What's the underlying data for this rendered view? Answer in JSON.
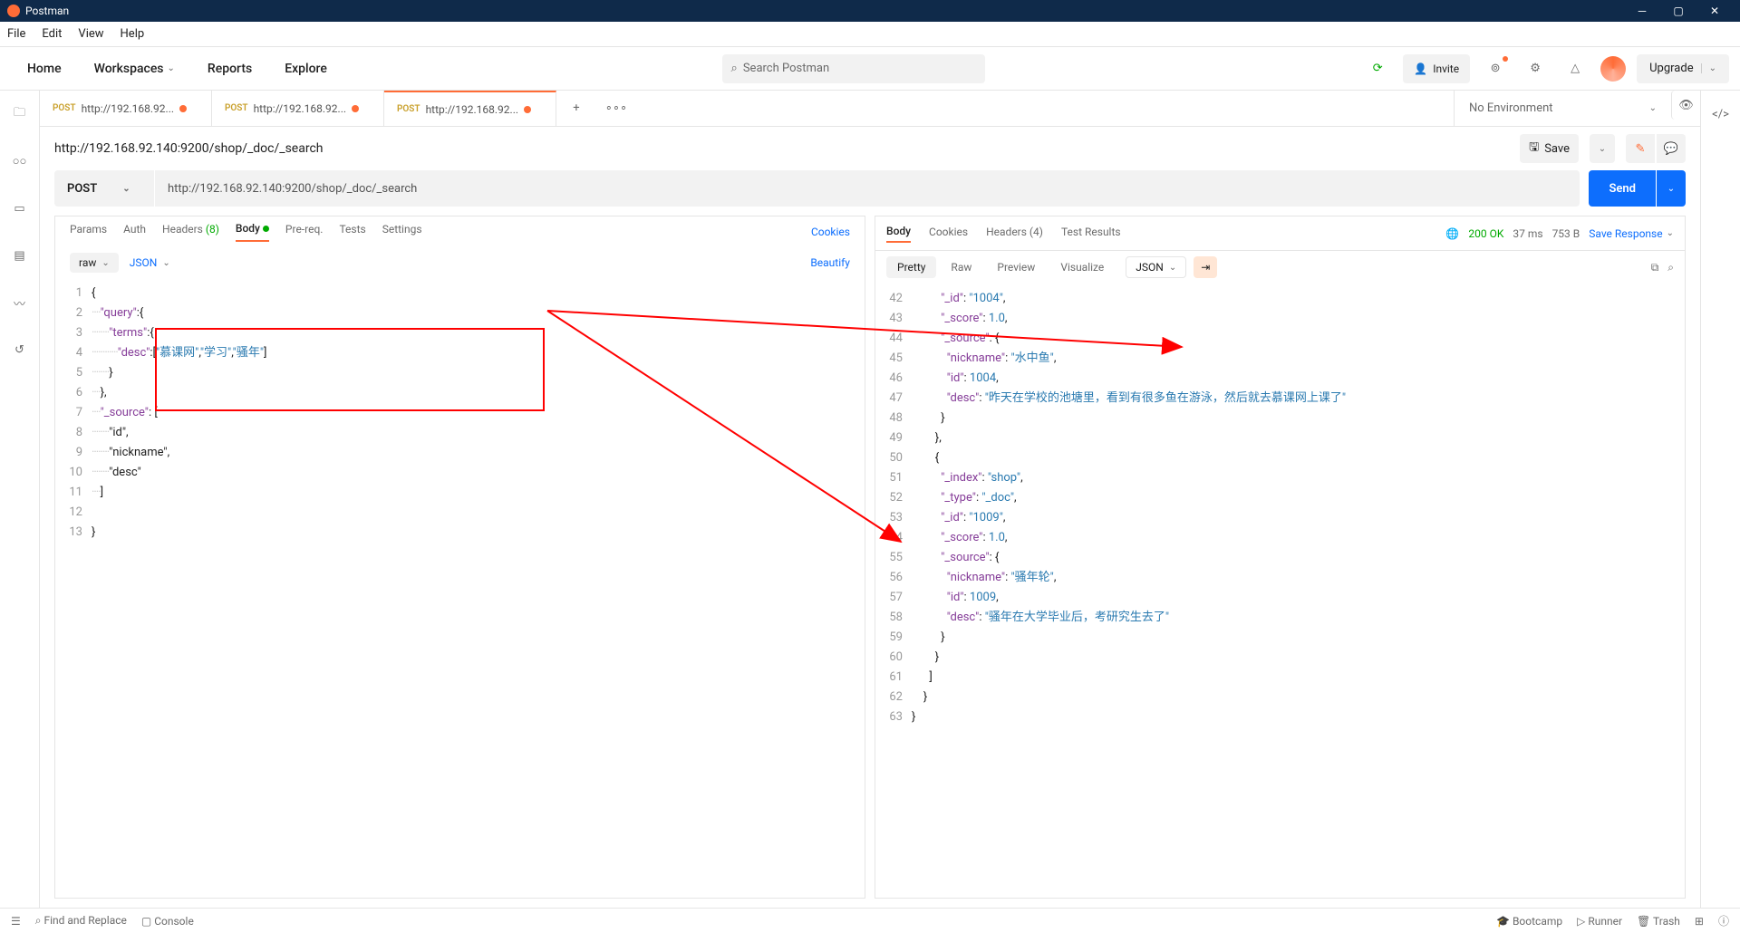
{
  "title_bar": {
    "app_name": "Postman"
  },
  "menu": {
    "file": "File",
    "edit": "Edit",
    "view": "View",
    "help": "Help"
  },
  "top_nav": {
    "home": "Home",
    "workspaces": "Workspaces",
    "reports": "Reports",
    "explore": "Explore",
    "search_placeholder": "Search Postman",
    "invite": "Invite",
    "upgrade": "Upgrade"
  },
  "tabs": [
    {
      "method": "POST",
      "url": "http://192.168.92...",
      "active": false
    },
    {
      "method": "POST",
      "url": "http://192.168.92...",
      "active": false
    },
    {
      "method": "POST",
      "url": "http://192.168.92...",
      "active": true
    }
  ],
  "env": "No Environment",
  "request": {
    "title": "http://192.168.92.140:9200/shop/_doc/_search",
    "save": "Save",
    "method": "POST",
    "url": "http://192.168.92.140:9200/shop/_doc/_search",
    "send": "Send"
  },
  "req_tabs": {
    "params": "Params",
    "auth": "Auth",
    "headers": "Headers",
    "headers_count": "(8)",
    "body": "Body",
    "prereq": "Pre-req.",
    "tests": "Tests",
    "settings": "Settings",
    "cookies": "Cookies"
  },
  "body_ctrl": {
    "raw": "raw",
    "json": "JSON",
    "beautify": "Beautify"
  },
  "request_body_lines": [
    "{",
    "····\"query\":{",
    "········\"terms\":{",
    "············\"desc\":[\"慕课网\",\"学习\",\"骚年\"]",
    "········}",
    "····},",
    "····\"_source\": [",
    "········\"id\",",
    "········\"nickname\",",
    "········\"desc\"",
    "····]",
    "",
    "}"
  ],
  "resp_tabs": {
    "body": "Body",
    "cookies": "Cookies",
    "headers": "Headers",
    "headers_count": "(4)",
    "results": "Test Results",
    "status": "200 OK",
    "time": "37 ms",
    "size": "753 B",
    "save_resp": "Save Response"
  },
  "resp_ctrl": {
    "pretty": "Pretty",
    "raw": "Raw",
    "preview": "Preview",
    "visualize": "Visualize",
    "json": "JSON"
  },
  "response_lines": [
    {
      "n": 42,
      "indent": 10,
      "txt": "\"_id\": \"1004\","
    },
    {
      "n": 43,
      "indent": 10,
      "txt": "\"_score\": 1.0,"
    },
    {
      "n": 44,
      "indent": 10,
      "txt": "\"_source\": {"
    },
    {
      "n": 45,
      "indent": 12,
      "txt": "\"nickname\": \"水中鱼\","
    },
    {
      "n": 46,
      "indent": 12,
      "txt": "\"id\": 1004,"
    },
    {
      "n": 47,
      "indent": 12,
      "txt": "\"desc\": \"昨天在学校的池塘里，看到有很多鱼在游泳，然后就去慕课网上课了\""
    },
    {
      "n": 48,
      "indent": 10,
      "txt": "}"
    },
    {
      "n": 49,
      "indent": 8,
      "txt": "},"
    },
    {
      "n": 50,
      "indent": 8,
      "txt": "{"
    },
    {
      "n": 51,
      "indent": 10,
      "txt": "\"_index\": \"shop\","
    },
    {
      "n": 52,
      "indent": 10,
      "txt": "\"_type\": \"_doc\","
    },
    {
      "n": 53,
      "indent": 10,
      "txt": "\"_id\": \"1009\","
    },
    {
      "n": 54,
      "indent": 10,
      "txt": "\"_score\": 1.0,"
    },
    {
      "n": 55,
      "indent": 10,
      "txt": "\"_source\": {"
    },
    {
      "n": 56,
      "indent": 12,
      "txt": "\"nickname\": \"骚年轮\","
    },
    {
      "n": 57,
      "indent": 12,
      "txt": "\"id\": 1009,"
    },
    {
      "n": 58,
      "indent": 12,
      "txt": "\"desc\": \"骚年在大学毕业后，考研究生去了\""
    },
    {
      "n": 59,
      "indent": 10,
      "txt": "}"
    },
    {
      "n": 60,
      "indent": 8,
      "txt": "}"
    },
    {
      "n": 61,
      "indent": 6,
      "txt": "]"
    },
    {
      "n": 62,
      "indent": 4,
      "txt": "}"
    },
    {
      "n": 63,
      "indent": 0,
      "txt": "}"
    }
  ],
  "status_bar": {
    "find": "Find and Replace",
    "console": "Console",
    "bootcamp": "Bootcamp",
    "runner": "Runner",
    "trash": "Trash"
  }
}
